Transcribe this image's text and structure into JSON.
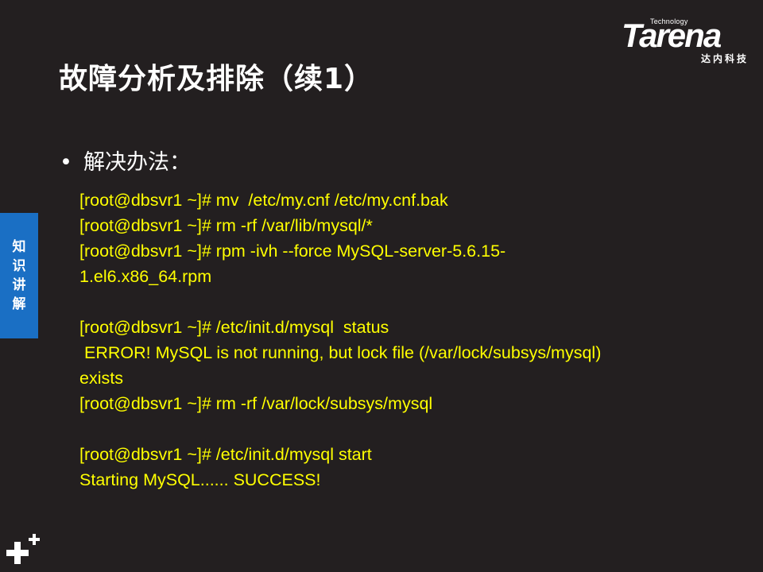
{
  "logo": {
    "tagline": "Technology",
    "brand": "Tarena",
    "cn": "达内科技"
  },
  "slide": {
    "title": "故障分析及排除（续1）",
    "bullet": "解决办法：",
    "side_tab": [
      "知",
      "识",
      "讲",
      "解"
    ]
  },
  "code_lines": [
    "[root@dbsvr1 ~]# mv  /etc/my.cnf /etc/my.cnf.bak",
    "[root@dbsvr1 ~]# rm -rf /var/lib/mysql/*",
    "[root@dbsvr1 ~]# rpm -ivh --force MySQL-server-5.6.15-",
    "1.el6.x86_64.rpm",
    "",
    "[root@dbsvr1 ~]# /etc/init.d/mysql  status",
    " ERROR! MySQL is not running, but lock file (/var/lock/subsys/mysql)",
    "exists",
    "[root@dbsvr1 ~]# rm -rf /var/lock/subsys/mysql",
    "",
    "[root@dbsvr1 ~]# /etc/init.d/mysql start",
    "Starting MySQL...... SUCCESS!"
  ],
  "colors": {
    "background": "#231f20",
    "code_text": "#ffff00",
    "side_tab": "#1a6fc4"
  },
  "icons": {
    "bullet": "bullet-dot-icon",
    "corner": "plus-icon"
  }
}
